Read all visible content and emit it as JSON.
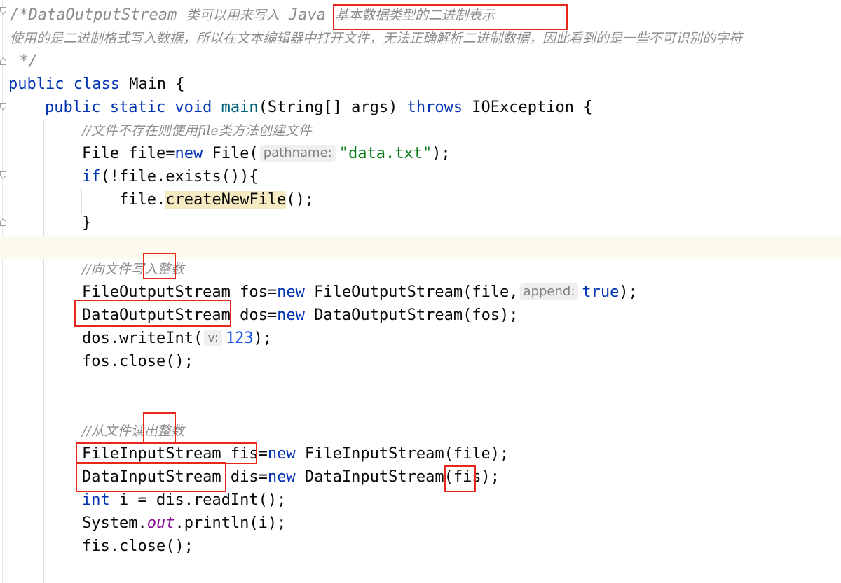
{
  "code": {
    "comment_line1_a": "/*DataOutputStream ",
    "comment_line1_b": "类可以用来写入",
    "comment_line1_c": " Java ",
    "comment_line1_d": "基本数据类型的二进制表示",
    "comment_line2": "使用的是二进制格式写入数据，所以在文本编辑器中打开文件，无法正确解析二进制数据，因此看到的是一些不可识别的字符",
    "comment_line3": " */",
    "class_kw": "public class",
    "class_rest": " Main {",
    "main_kw": "public static void",
    "main_name": "main",
    "main_args": "(String[] args) ",
    "main_throws": "throws",
    "main_rest": " IOException {",
    "comment_create": "//文件不存在则使用file类方法创建文件",
    "file_decl_a": "File file=",
    "file_decl_new": "new",
    "file_decl_b": " File(",
    "hint_pathname": "pathname:",
    "file_decl_str": "\"data.txt\"",
    "file_decl_end": ");",
    "if_kw": "if",
    "if_rest": "(!file.exists()){",
    "create_a": "file.",
    "create_method": "createNewFile",
    "create_end": "();",
    "close_brace": "}",
    "comment_write": "//向文件写入整数",
    "fos_a": "FileOutputStream fos=",
    "fos_new": "new",
    "fos_b": " FileOutputStream(file,",
    "hint_append": "append:",
    "fos_true": "true",
    "fos_end": ");",
    "dos_a": "DataOutputStream dos=",
    "dos_new": "new",
    "dos_b": " DataOutputStream(fos);",
    "write_a": "dos.writeInt(",
    "hint_v": "v:",
    "write_num": "123",
    "write_end": ");",
    "fos_close": "fos.close();",
    "comment_read": "//从文件读出整数",
    "fis_a": "FileInputStream fis=",
    "fis_new": "new",
    "fis_b": " FileInputStream(file);",
    "dis_a": "DataInputStream dis=",
    "dis_new": "new",
    "dis_b": " DataInputStream(fis);",
    "int_kw": "int",
    "int_rest": " i = dis.readInt();",
    "print_a": "System.",
    "print_out": "out",
    "print_b": ".println(i);",
    "fis_close": "fis.close();"
  },
  "colors": {
    "keyword": "#0033b3",
    "string": "#067d17",
    "number": "#1750eb",
    "comment": "#8c8c8c",
    "annotation_box": "#e8261c"
  }
}
